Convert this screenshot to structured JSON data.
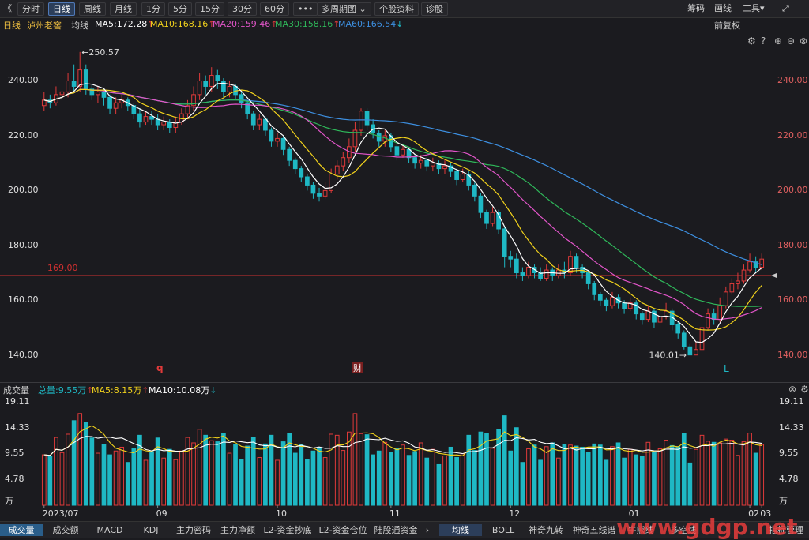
{
  "toolbar": {
    "back_icon": "double-chevron-left-icon",
    "periods": [
      "分时",
      "日线",
      "周线",
      "月线",
      "1分",
      "5分",
      "15分",
      "30分",
      "60分"
    ],
    "active_period": "日线",
    "more": "•••",
    "multi_period": "多周期图",
    "profile": "个股资料",
    "diagnose": "诊股",
    "chips": "筹码",
    "draw": "画线",
    "tools": "工具",
    "expand_icon": "expand-icon"
  },
  "info": {
    "period": "日线",
    "stock": "泸州老窖",
    "ma_label": "均线",
    "ma5": "MA5:172.28",
    "ma10": "MA10:168.16",
    "ma20": "MA20:159.46",
    "ma30": "MA30:158.16",
    "ma60": "MA60:166.54",
    "adjust": "前复权"
  },
  "volume_info": {
    "label": "成交量",
    "total": "总量:9.55万",
    "ma5": "MA5:8.15万",
    "ma10": "MA10:10.08万"
  },
  "colors": {
    "up": "#e03a3a",
    "down": "#1fb8c4",
    "ma5": "#ffffff",
    "ma10": "#f2d21c",
    "ma20": "#e255c9",
    "ma30": "#2fb85a",
    "ma60": "#3d8fe0",
    "refline": "#d03030"
  },
  "chart_data": [
    {
      "type": "candlestick",
      "title": "泸州老窖 日线",
      "price_ticks": [
        "240.00",
        "220.00",
        "200.00",
        "180.00",
        "160.00",
        "140.00"
      ],
      "ylim": [
        133,
        258
      ],
      "reference_line": {
        "value": 169.0,
        "label": "169.00"
      },
      "annotations": {
        "high": "←250.57",
        "low": "140.01→",
        "marker_q": "q",
        "marker_cai": "财",
        "marker_l": "L"
      },
      "x_ticks": [
        "2023/07",
        "09",
        "10",
        "11",
        "12",
        "01",
        "02",
        "03"
      ],
      "candles": [
        [
          231,
          233,
          236,
          229
        ],
        [
          233,
          232,
          235,
          230
        ],
        [
          232,
          235,
          238,
          231
        ],
        [
          235,
          236,
          239,
          232
        ],
        [
          236,
          240,
          243,
          234
        ],
        [
          240,
          238,
          246,
          236
        ],
        [
          238,
          244,
          250.57,
          236
        ],
        [
          244,
          237,
          246,
          235
        ],
        [
          237,
          235,
          239,
          233
        ],
        [
          235,
          236,
          238,
          232
        ],
        [
          236,
          234,
          237,
          231
        ],
        [
          234,
          230,
          235,
          228
        ],
        [
          230,
          232,
          234,
          228
        ],
        [
          232,
          233,
          235,
          230
        ],
        [
          233,
          231,
          234,
          229
        ],
        [
          231,
          228,
          232,
          226
        ],
        [
          228,
          225,
          230,
          223
        ],
        [
          225,
          227,
          229,
          224
        ],
        [
          227,
          226,
          229,
          224
        ],
        [
          226,
          224,
          228,
          222
        ],
        [
          224,
          225,
          227,
          222
        ],
        [
          225,
          223,
          226,
          221
        ],
        [
          223,
          225,
          227,
          221
        ],
        [
          225,
          228,
          230,
          224
        ],
        [
          228,
          231,
          233,
          226
        ],
        [
          231,
          235,
          238,
          229
        ],
        [
          235,
          240,
          243,
          233
        ],
        [
          240,
          238,
          242,
          235
        ],
        [
          238,
          242,
          245,
          236
        ],
        [
          242,
          240,
          244,
          237
        ],
        [
          240,
          236,
          241,
          234
        ],
        [
          236,
          238,
          240,
          234
        ],
        [
          238,
          235,
          239,
          233
        ],
        [
          235,
          232,
          236,
          230
        ],
        [
          232,
          228,
          233,
          226
        ],
        [
          228,
          224,
          229,
          222
        ],
        [
          224,
          226,
          228,
          222
        ],
        [
          226,
          222,
          227,
          220
        ],
        [
          222,
          218,
          223,
          216
        ],
        [
          218,
          219,
          221,
          216
        ],
        [
          219,
          215,
          220,
          213
        ],
        [
          215,
          211,
          216,
          209
        ],
        [
          211,
          208,
          212,
          206
        ],
        [
          208,
          205,
          209,
          203
        ],
        [
          205,
          202,
          206,
          200
        ],
        [
          202,
          199,
          203,
          197
        ],
        [
          199,
          198,
          201,
          196
        ],
        [
          198,
          200,
          203,
          197
        ],
        [
          200,
          206,
          208,
          199
        ],
        [
          206,
          209,
          211,
          204
        ],
        [
          209,
          212,
          214,
          207
        ],
        [
          212,
          216,
          219,
          210
        ],
        [
          216,
          222,
          225,
          214
        ],
        [
          222,
          229,
          230,
          220
        ],
        [
          229,
          224,
          230,
          222
        ],
        [
          224,
          221,
          226,
          219
        ],
        [
          221,
          218,
          222,
          216
        ],
        [
          218,
          220,
          222,
          216
        ],
        [
          220,
          216,
          221,
          214
        ],
        [
          216,
          213,
          217,
          211
        ],
        [
          213,
          215,
          217,
          212
        ],
        [
          215,
          212,
          216,
          210
        ],
        [
          212,
          210,
          213,
          208
        ],
        [
          210,
          211,
          213,
          208
        ],
        [
          211,
          209,
          212,
          207
        ],
        [
          209,
          210,
          212,
          207
        ],
        [
          210,
          208,
          211,
          206
        ],
        [
          208,
          209,
          211,
          206
        ],
        [
          209,
          207,
          210,
          205
        ],
        [
          207,
          204,
          208,
          202
        ],
        [
          204,
          206,
          208,
          203
        ],
        [
          206,
          202,
          207,
          200
        ],
        [
          202,
          198,
          203,
          196
        ],
        [
          198,
          192,
          199,
          190
        ],
        [
          192,
          188,
          193,
          186
        ],
        [
          188,
          192,
          194,
          187
        ],
        [
          192,
          186,
          193,
          184
        ],
        [
          186,
          176,
          187,
          172
        ],
        [
          176,
          175,
          178,
          172
        ],
        [
          175,
          170,
          177,
          168
        ],
        [
          170,
          169,
          172,
          167
        ],
        [
          169,
          172,
          174,
          168
        ],
        [
          172,
          170,
          173,
          168
        ],
        [
          170,
          168,
          172,
          167
        ],
        [
          168,
          171,
          173,
          167
        ],
        [
          171,
          169,
          172,
          167
        ],
        [
          169,
          171,
          173,
          168
        ],
        [
          171,
          170,
          174,
          168
        ],
        [
          170,
          176,
          178,
          169
        ],
        [
          176,
          172,
          177,
          170
        ],
        [
          172,
          170,
          173,
          168
        ],
        [
          170,
          166,
          171,
          164
        ],
        [
          166,
          162,
          167,
          160
        ],
        [
          162,
          160,
          163,
          158
        ],
        [
          160,
          158,
          161,
          156
        ],
        [
          158,
          161,
          163,
          157
        ],
        [
          161,
          159,
          162,
          157
        ],
        [
          159,
          157,
          160,
          155
        ],
        [
          157,
          159,
          161,
          156
        ],
        [
          159,
          155,
          160,
          153
        ],
        [
          155,
          153,
          156,
          151
        ],
        [
          153,
          156,
          158,
          152
        ],
        [
          156,
          152,
          157,
          150
        ],
        [
          152,
          154,
          156,
          150
        ],
        [
          154,
          156,
          159,
          153
        ],
        [
          156,
          151,
          157,
          149
        ],
        [
          151,
          148,
          152,
          146
        ],
        [
          148,
          143,
          149,
          142
        ],
        [
          143,
          140.01,
          144,
          140
        ],
        [
          140,
          142,
          145,
          140
        ],
        [
          142,
          150,
          152,
          141
        ],
        [
          150,
          155,
          157,
          149
        ],
        [
          155,
          153,
          157,
          151
        ],
        [
          153,
          158,
          161,
          152
        ],
        [
          158,
          163,
          165,
          157
        ],
        [
          163,
          166,
          168,
          162
        ],
        [
          166,
          167,
          170,
          164
        ],
        [
          167,
          171,
          173,
          166
        ],
        [
          171,
          174,
          177,
          170
        ],
        [
          174,
          172,
          176,
          170
        ],
        [
          172,
          175,
          177,
          171
        ]
      ]
    },
    {
      "type": "bar",
      "title": "成交量",
      "y_ticks": [
        "19.11",
        "14.33",
        "9.55",
        "4.78",
        "万"
      ],
      "ylim": [
        0,
        19.5
      ],
      "unit": "万"
    }
  ],
  "bottom_tabs_left": [
    "成交量",
    "成交额",
    "MACD",
    "KDJ",
    "主力密码",
    "主力净额",
    "L2-资金抄底",
    "L2-资金仓位",
    "陆股通资金"
  ],
  "bottom_tabs_right": [
    "均线",
    "BOLL",
    "神奇九转",
    "神奇五线谱",
    "牛熊线",
    "多空线",
    "指标管理"
  ],
  "watermark": "www.gdgp.net"
}
